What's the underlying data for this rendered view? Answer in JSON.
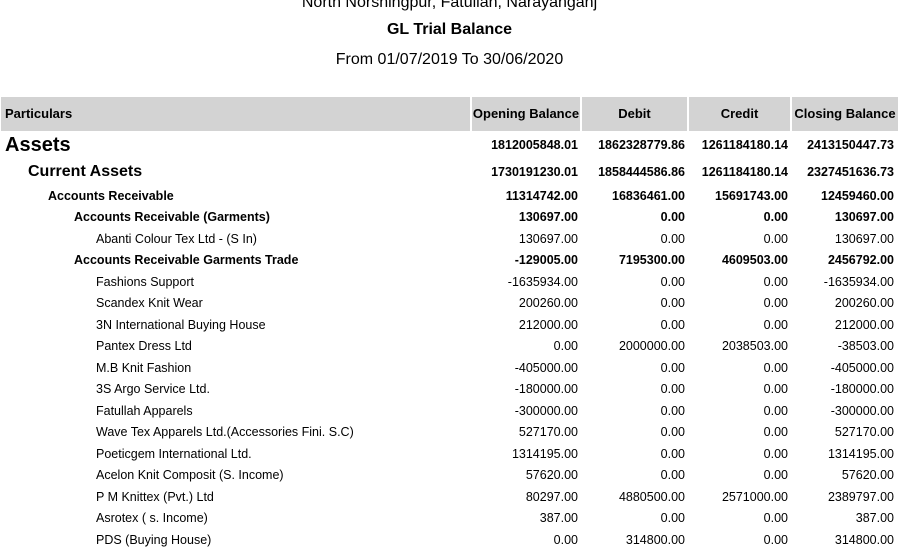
{
  "report": {
    "address": "North Norshingpur, Fatullah, Narayanganj",
    "title": "GL Trial Balance",
    "period": "From 01/07/2019 To 30/06/2020"
  },
  "columns": {
    "particulars": "Particulars",
    "opening": "Opening Balance",
    "debit": "Debit",
    "credit": "Credit",
    "closing": "Closing Balance"
  },
  "rows": [
    {
      "name": "Assets",
      "opening": "1812005848.01",
      "debit": "1862328779.86",
      "credit": "1261184180.14",
      "closing": "2413150447.73"
    },
    {
      "name": "Current Assets",
      "opening": "1730191230.01",
      "debit": "1858444586.86",
      "credit": "1261184180.14",
      "closing": "2327451636.73"
    },
    {
      "name": "Accounts Receivable",
      "opening": "11314742.00",
      "debit": "16836461.00",
      "credit": "15691743.00",
      "closing": "12459460.00"
    },
    {
      "name": "Accounts Receivable (Garments)",
      "opening": "130697.00",
      "debit": "0.00",
      "credit": "0.00",
      "closing": "130697.00"
    },
    {
      "name": "Abanti Colour Tex Ltd - (S In)",
      "opening": "130697.00",
      "debit": "0.00",
      "credit": "0.00",
      "closing": "130697.00"
    },
    {
      "name": "Accounts Receivable Garments Trade",
      "opening": "-129005.00",
      "debit": "7195300.00",
      "credit": "4609503.00",
      "closing": "2456792.00"
    },
    {
      "name": "Fashions Support",
      "opening": "-1635934.00",
      "debit": "0.00",
      "credit": "0.00",
      "closing": "-1635934.00"
    },
    {
      "name": "Scandex  Knit Wear",
      "opening": "200260.00",
      "debit": "0.00",
      "credit": "0.00",
      "closing": "200260.00"
    },
    {
      "name": "3N International Buying House",
      "opening": "212000.00",
      "debit": "0.00",
      "credit": "0.00",
      "closing": "212000.00"
    },
    {
      "name": "Pantex Dress Ltd",
      "opening": "0.00",
      "debit": "2000000.00",
      "credit": "2038503.00",
      "closing": "-38503.00"
    },
    {
      "name": "M.B Knit Fashion",
      "opening": "-405000.00",
      "debit": "0.00",
      "credit": "0.00",
      "closing": "-405000.00"
    },
    {
      "name": "3S Argo Service Ltd.",
      "opening": "-180000.00",
      "debit": "0.00",
      "credit": "0.00",
      "closing": "-180000.00"
    },
    {
      "name": "Fatullah Apparels",
      "opening": "-300000.00",
      "debit": "0.00",
      "credit": "0.00",
      "closing": "-300000.00"
    },
    {
      "name": "Wave Tex Apparels Ltd.(Accessories Fini. S.C)",
      "opening": "527170.00",
      "debit": "0.00",
      "credit": "0.00",
      "closing": "527170.00"
    },
    {
      "name": "Poeticgem International Ltd.",
      "opening": "1314195.00",
      "debit": "0.00",
      "credit": "0.00",
      "closing": "1314195.00"
    },
    {
      "name": "Acelon Knit Composit (S. Income)",
      "opening": "57620.00",
      "debit": "0.00",
      "credit": "0.00",
      "closing": "57620.00"
    },
    {
      "name": "P M Knittex (Pvt.) Ltd",
      "opening": "80297.00",
      "debit": "4880500.00",
      "credit": "2571000.00",
      "closing": "2389797.00"
    },
    {
      "name": "Asrotex ( s. Income)",
      "opening": "387.00",
      "debit": "0.00",
      "credit": "0.00",
      "closing": "387.00"
    },
    {
      "name": "PDS (Buying House)",
      "opening": "0.00",
      "debit": "314800.00",
      "credit": "0.00",
      "closing": "314800.00"
    }
  ]
}
